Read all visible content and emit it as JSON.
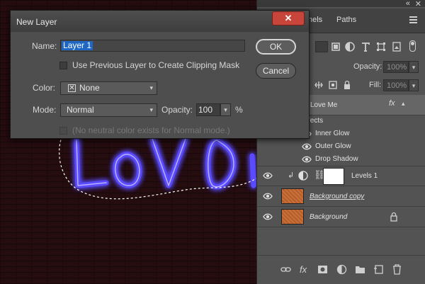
{
  "dialog": {
    "title": "New Layer",
    "close_glyph": "✕",
    "name_label": "Name:",
    "name_value": "Layer 1",
    "clip_label": "Use Previous Layer to Create Clipping Mask",
    "color_label": "Color:",
    "color_value": "None",
    "mode_label": "Mode:",
    "mode_value": "Normal",
    "opacity_label": "Opacity:",
    "opacity_value": "100",
    "percent": "%",
    "neutral_label": "(No neutral color exists for Normal mode.)",
    "ok_label": "OK",
    "cancel_label": "Cancel"
  },
  "panel": {
    "tab_partial": "nels",
    "tab_paths": "Paths",
    "opacity_label": "Opacity:",
    "opacity_value": "100%",
    "fill_label": "Fill:",
    "fill_value": "100%",
    "layers": {
      "love_me": "Love Me",
      "effects": "fects",
      "inner_glow": "Inner Glow",
      "outer_glow": "Outer Glow",
      "drop_shadow": "Drop Shadow",
      "levels": "Levels 1",
      "bg_copy": "Background copy",
      "background": "Background"
    },
    "fx_label": "fx"
  },
  "colors": {
    "glow": "#5a4cff",
    "selection_highlight": "#1f67c5",
    "close_red": "#c7453a"
  }
}
